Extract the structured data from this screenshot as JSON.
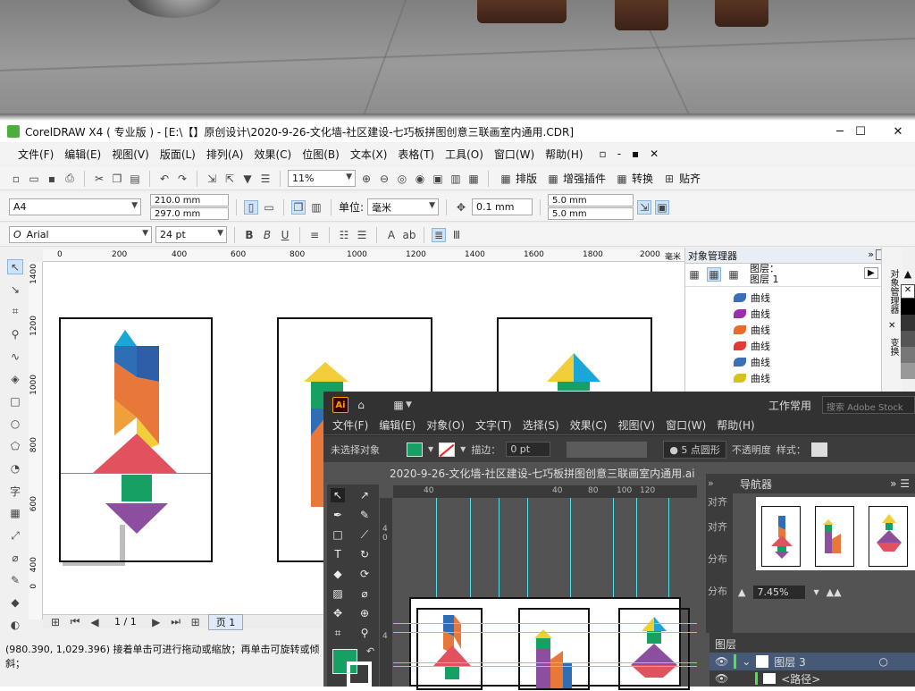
{
  "window": {
    "title": "CorelDRAW X4 ( 专业版 ) - [E:\\【】原创设计\\2020-9-26-文化墙-社区建设-七巧板拼图创意三联画室内通用.CDR]",
    "minimize": "─",
    "maximize": "☐",
    "close": "✕"
  },
  "menu": [
    "文件(F)",
    "编辑(E)",
    "视图(V)",
    "版面(L)",
    "排列(A)",
    "效果(C)",
    "位图(B)",
    "文本(X)",
    "表格(T)",
    "工具(O)",
    "窗口(W)",
    "帮助(H)"
  ],
  "menu_right": [
    "▫",
    "-",
    "▪",
    "✕"
  ],
  "toolbar1": {
    "zoom": "11%",
    "labels": [
      "排版",
      "增强插件",
      "转换",
      "贴齐"
    ]
  },
  "propbar": {
    "page_size": "A4",
    "width": "210.0 mm",
    "height": "297.0 mm",
    "unit_label": "单位:",
    "unit": "毫米",
    "nudge": "0.1 mm",
    "dup_x": "5.0 mm",
    "dup_y": "5.0 mm"
  },
  "textbar": {
    "font": "Arial",
    "size": "24 pt"
  },
  "ruler_h": [
    "0",
    "200",
    "400",
    "600",
    "800",
    "1000",
    "1200",
    "1400",
    "1600",
    "1800",
    "2000",
    "毫米"
  ],
  "ruler_v": [
    "1400",
    "1200",
    "1000",
    "800",
    "600",
    "400",
    "200",
    "0"
  ],
  "page_nav": {
    "count": "1 / 1",
    "page_tab": "页 1"
  },
  "status": "(980.390, 1,029.396) 接着单击可进行拖动或缩放；再单击可旋转或倾斜；",
  "object_manager": {
    "title": "对象管理器",
    "layer_line1": "图层：",
    "layer_line2": "图层 1",
    "items": [
      "曲线",
      "曲线",
      "曲线",
      "曲线",
      "曲线",
      "曲线"
    ],
    "item_colors": [
      "#3b6fb6",
      "#9b2fae",
      "#e86a2c",
      "#e53935",
      "#3b6fb6",
      "#d8c21a"
    ]
  },
  "side_tabs": [
    "对象管理器",
    "变换"
  ],
  "illustrator": {
    "logo": "Ai",
    "home_icon": "home-icon",
    "workspace": "工作常用",
    "search_placeholder": "搜索 Adobe Stock",
    "menu": [
      "文件(F)",
      "编辑(E)",
      "对象(O)",
      "文字(T)",
      "选择(S)",
      "效果(C)",
      "视图(V)",
      "窗口(W)",
      "帮助(H)"
    ],
    "ctrl": {
      "no_selection": "未选择对象",
      "stroke_label": "描边：",
      "stroke_value": "0 pt",
      "brush": "5 点圆形",
      "opacity": "不透明度",
      "style": "样式："
    },
    "doc_tab": "2020-9-26-文化墙-社区建设-七巧板拼图创意三联画室内通用.ai",
    "ruler_h": [
      "40",
      "20",
      "0",
      "20",
      "40",
      "60",
      "80",
      "100",
      "120"
    ],
    "ruler_v": [
      "4",
      "0",
      "2",
      "4"
    ],
    "navigator": {
      "title": "导航器",
      "zoom": "7.45%"
    },
    "side_labels": [
      "对齐",
      "对齐",
      "分布",
      "分布"
    ],
    "layers": {
      "title": "图层",
      "layer_name": "图层 3",
      "sublayer": "<路径>"
    }
  },
  "colors": {
    "blue": "#2f6db5",
    "cyan": "#1aa6d9",
    "orange": "#e8783a",
    "yellow": "#f2cf3a",
    "red": "#e2525e",
    "green": "#17a064",
    "purple": "#8c4fa0",
    "ai_swatch_fill": "#17a064"
  }
}
